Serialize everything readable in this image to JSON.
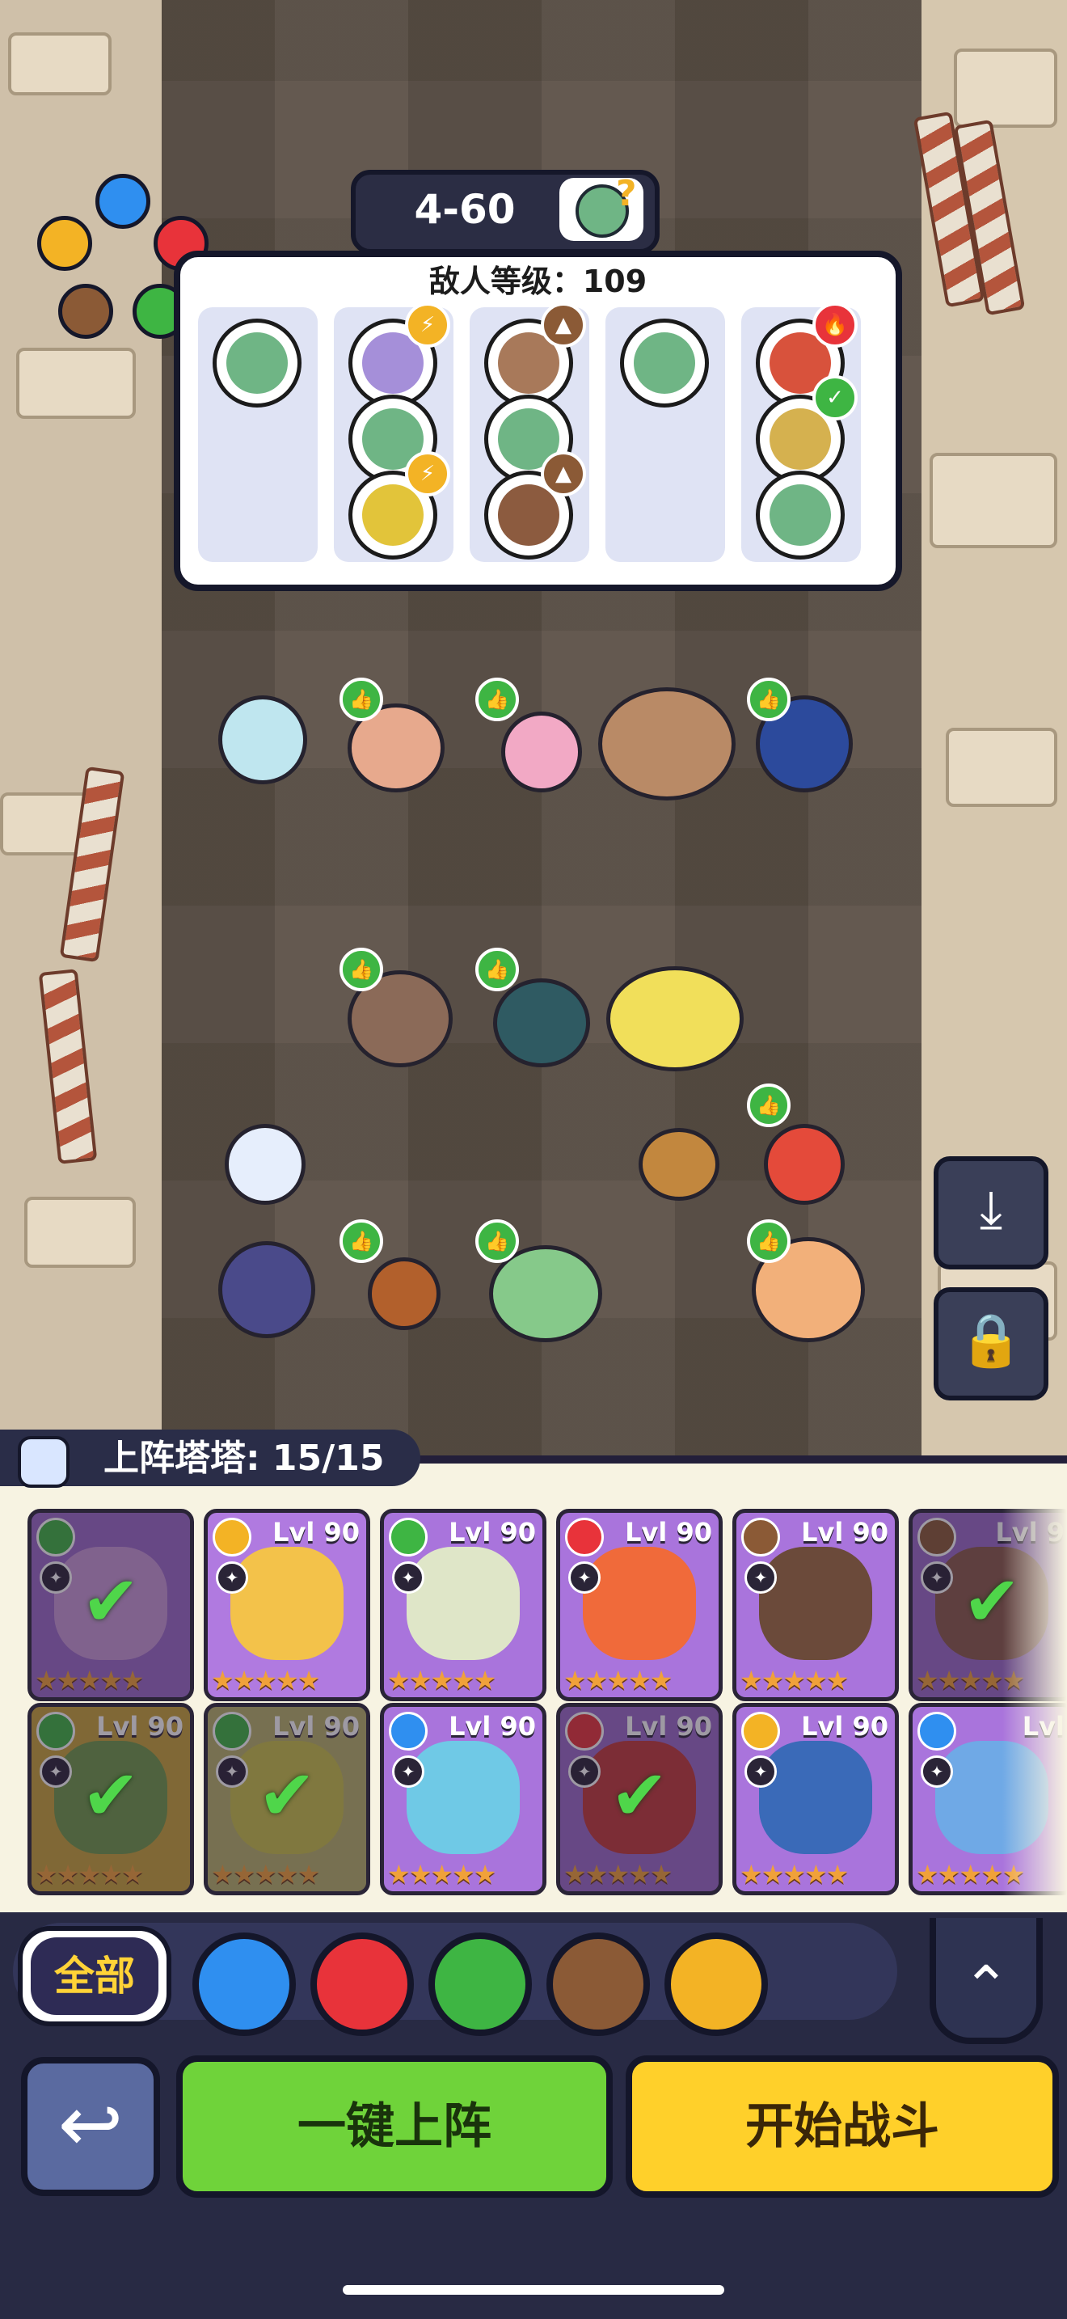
{
  "stage": {
    "label": "4-60"
  },
  "enemy_panel": {
    "title": "敌人等级：109",
    "columns": [
      {
        "enemies": [
          {
            "icon": "zombie-green",
            "badge": null
          }
        ]
      },
      {
        "enemies": [
          {
            "icon": "zombie-goggles",
            "badge": "lightning"
          },
          {
            "icon": "zombie-green",
            "badge": null
          },
          {
            "icon": "zombie-yellow-helmet",
            "badge": "lightning"
          }
        ]
      },
      {
        "enemies": [
          {
            "icon": "zombie-cowboy",
            "badge": "earth"
          },
          {
            "icon": "zombie-green",
            "badge": null
          },
          {
            "icon": "zombie-brown",
            "badge": "earth"
          }
        ]
      },
      {
        "enemies": [
          {
            "icon": "zombie-green",
            "badge": null
          }
        ]
      },
      {
        "enemies": [
          {
            "icon": "zombie-red",
            "badge": "fire"
          },
          {
            "icon": "zombie-cat",
            "badge": "leaf"
          },
          {
            "icon": "zombie-green",
            "badge": null
          }
        ]
      }
    ]
  },
  "element_wheel": [
    "water",
    "fire",
    "leaf",
    "earth",
    "lightning"
  ],
  "deployed": {
    "label": "上阵塔塔: 15/15"
  },
  "cards": [
    {
      "level": "",
      "element": "leaf",
      "deployed": true,
      "stars": "★★★★★"
    },
    {
      "level": "Lvl 90",
      "element": "lightning",
      "deployed": false,
      "stars": "★★★★★"
    },
    {
      "level": "Lvl 90",
      "element": "leaf",
      "deployed": false,
      "stars": "★★★★★"
    },
    {
      "level": "Lvl 90",
      "element": "fire",
      "deployed": false,
      "stars": "★★★★★"
    },
    {
      "level": "Lvl 90",
      "element": "earth",
      "deployed": false,
      "stars": "★★★★★"
    },
    {
      "level": "Lvl 9",
      "element": "earth",
      "deployed": true,
      "stars": "★★★★★"
    },
    {
      "level": "Lvl 90",
      "element": "leaf",
      "deployed": true,
      "stars": "★★★★★"
    },
    {
      "level": "Lvl 90",
      "element": "leaf",
      "deployed": true,
      "stars": "★★★★★"
    },
    {
      "level": "Lvl 90",
      "element": "water",
      "deployed": false,
      "stars": "★★★★★"
    },
    {
      "level": "Lvl 90",
      "element": "fire",
      "deployed": true,
      "stars": "★★★★★"
    },
    {
      "level": "Lvl 90",
      "element": "lightning",
      "deployed": false,
      "stars": "★★★★★"
    },
    {
      "level": "Lvl",
      "element": "water",
      "deployed": false,
      "stars": "★★★★★"
    }
  ],
  "filters": {
    "all_label": "全部",
    "elements": [
      "water",
      "fire",
      "leaf",
      "earth",
      "lightning"
    ]
  },
  "buttons": {
    "auto_deploy": "一键上阵",
    "start_battle": "开始战斗"
  },
  "colors": {
    "water": "#2f8ff0",
    "fire": "#e8333a",
    "leaf": "#3eb543",
    "earth": "#8b5a36",
    "lightning": "#f3b325"
  }
}
